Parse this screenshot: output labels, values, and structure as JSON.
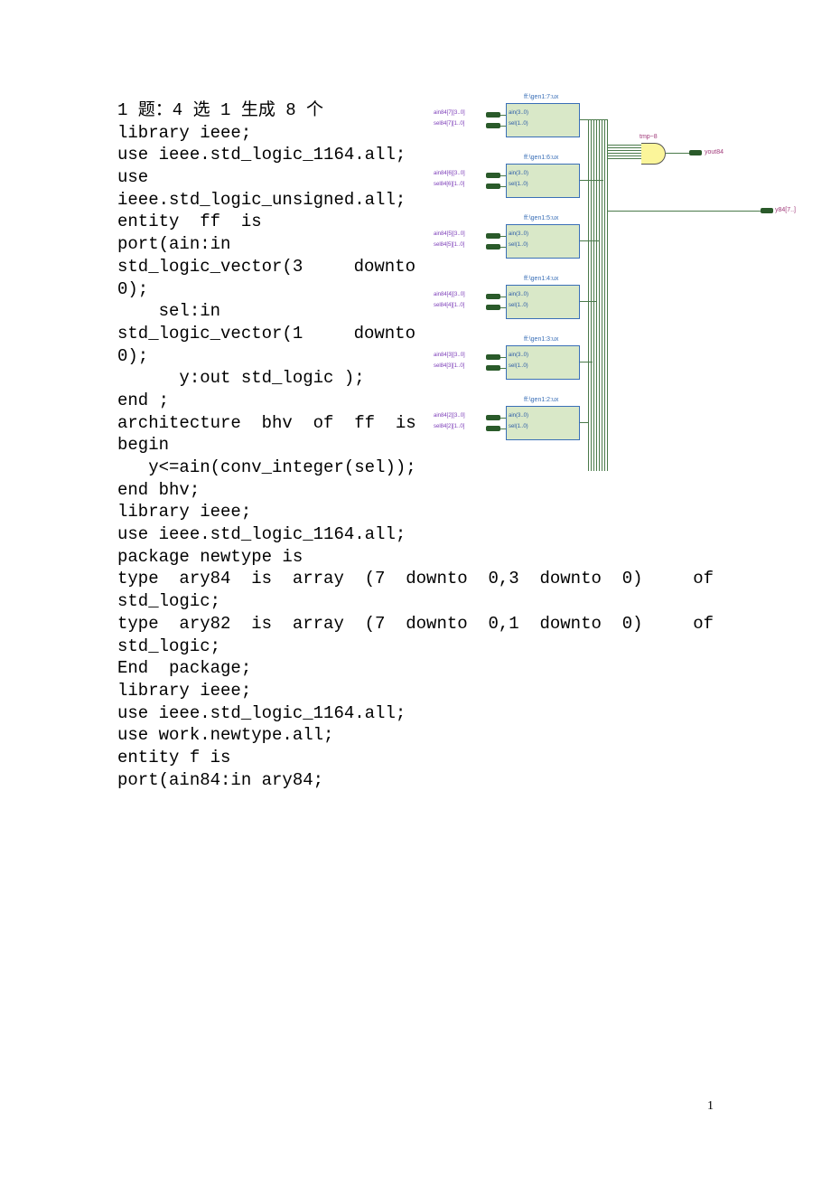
{
  "title": "1 题：4 选 1 生成 8 个",
  "code1": [
    "library ieee;",
    "use ieee.std_logic_1164.all;",
    "use",
    "ieee.std_logic_unsigned.all;",
    "entity  ff  is",
    "port(ain:in"
  ],
  "j1": {
    "a": "std_logic_vector(3",
    "b": "downto"
  },
  "code2": [
    "0);",
    "    sel:in"
  ],
  "j2": {
    "a": "std_logic_vector(1",
    "b": "downto"
  },
  "code3": [
    "0);",
    "      y:out std_logic );",
    "end ;",
    "",
    "architecture  bhv  of  ff  is",
    "begin",
    "   y<=ain(conv_integer(sel));",
    "end bhv;",
    "",
    "library ieee;",
    "use ieee.std_logic_1164.all;",
    "package newtype is"
  ],
  "j3": {
    "a": "type  ary84  is  array  (7  downto  0,3  downto  0)",
    "b": "of"
  },
  "code4": [
    "std_logic;"
  ],
  "j4": {
    "a": "type  ary82  is  array  (7  downto  0,1  downto  0)",
    "b": "of"
  },
  "code5": [
    "std_logic;",
    "End  package;",
    "",
    "",
    "library ieee;",
    "use ieee.std_logic_1164.all;",
    "use work.newtype.all;",
    "entity f is",
    "port(ain84:in ary84;"
  ],
  "pageNum": "1",
  "diagram": {
    "blocks": [
      {
        "label": "ff:\\gen1:7:ux",
        "ain": "ain84[7][3..0]",
        "sel": "sel84[7][1..0]",
        "pin": "ain(3..0)",
        "psel": "sel(1..0)"
      },
      {
        "label": "ff:\\gen1:6:ux",
        "ain": "ain84[6][3..0]",
        "sel": "sel84[6][1..0]",
        "pin": "ain(3..0)",
        "psel": "sel(1..0)"
      },
      {
        "label": "ff:\\gen1:5:ux",
        "ain": "ain84[5][3..0]",
        "sel": "sel84[5][1..0]",
        "pin": "ain(3..0)",
        "psel": "sel(1..0)"
      },
      {
        "label": "ff:\\gen1:4:ux",
        "ain": "ain84[4][3..0]",
        "sel": "sel84[4][1..0]",
        "pin": "ain(3..0)",
        "psel": "sel(1..0)"
      },
      {
        "label": "ff:\\gen1:3:ux",
        "ain": "ain84[3][3..0]",
        "sel": "sel84[3][1..0]",
        "pin": "ain(3..0)",
        "psel": "sel(1..0)"
      },
      {
        "label": "ff:\\gen1:2:ux",
        "ain": "ain84[2][3..0]",
        "sel": "sel84[2][1..0]",
        "pin": "ain(3..0)",
        "psel": "sel(1..0)"
      }
    ],
    "gateLabel": "tmp~8",
    "out1": "yout84",
    "out2": "y84[7..]"
  }
}
